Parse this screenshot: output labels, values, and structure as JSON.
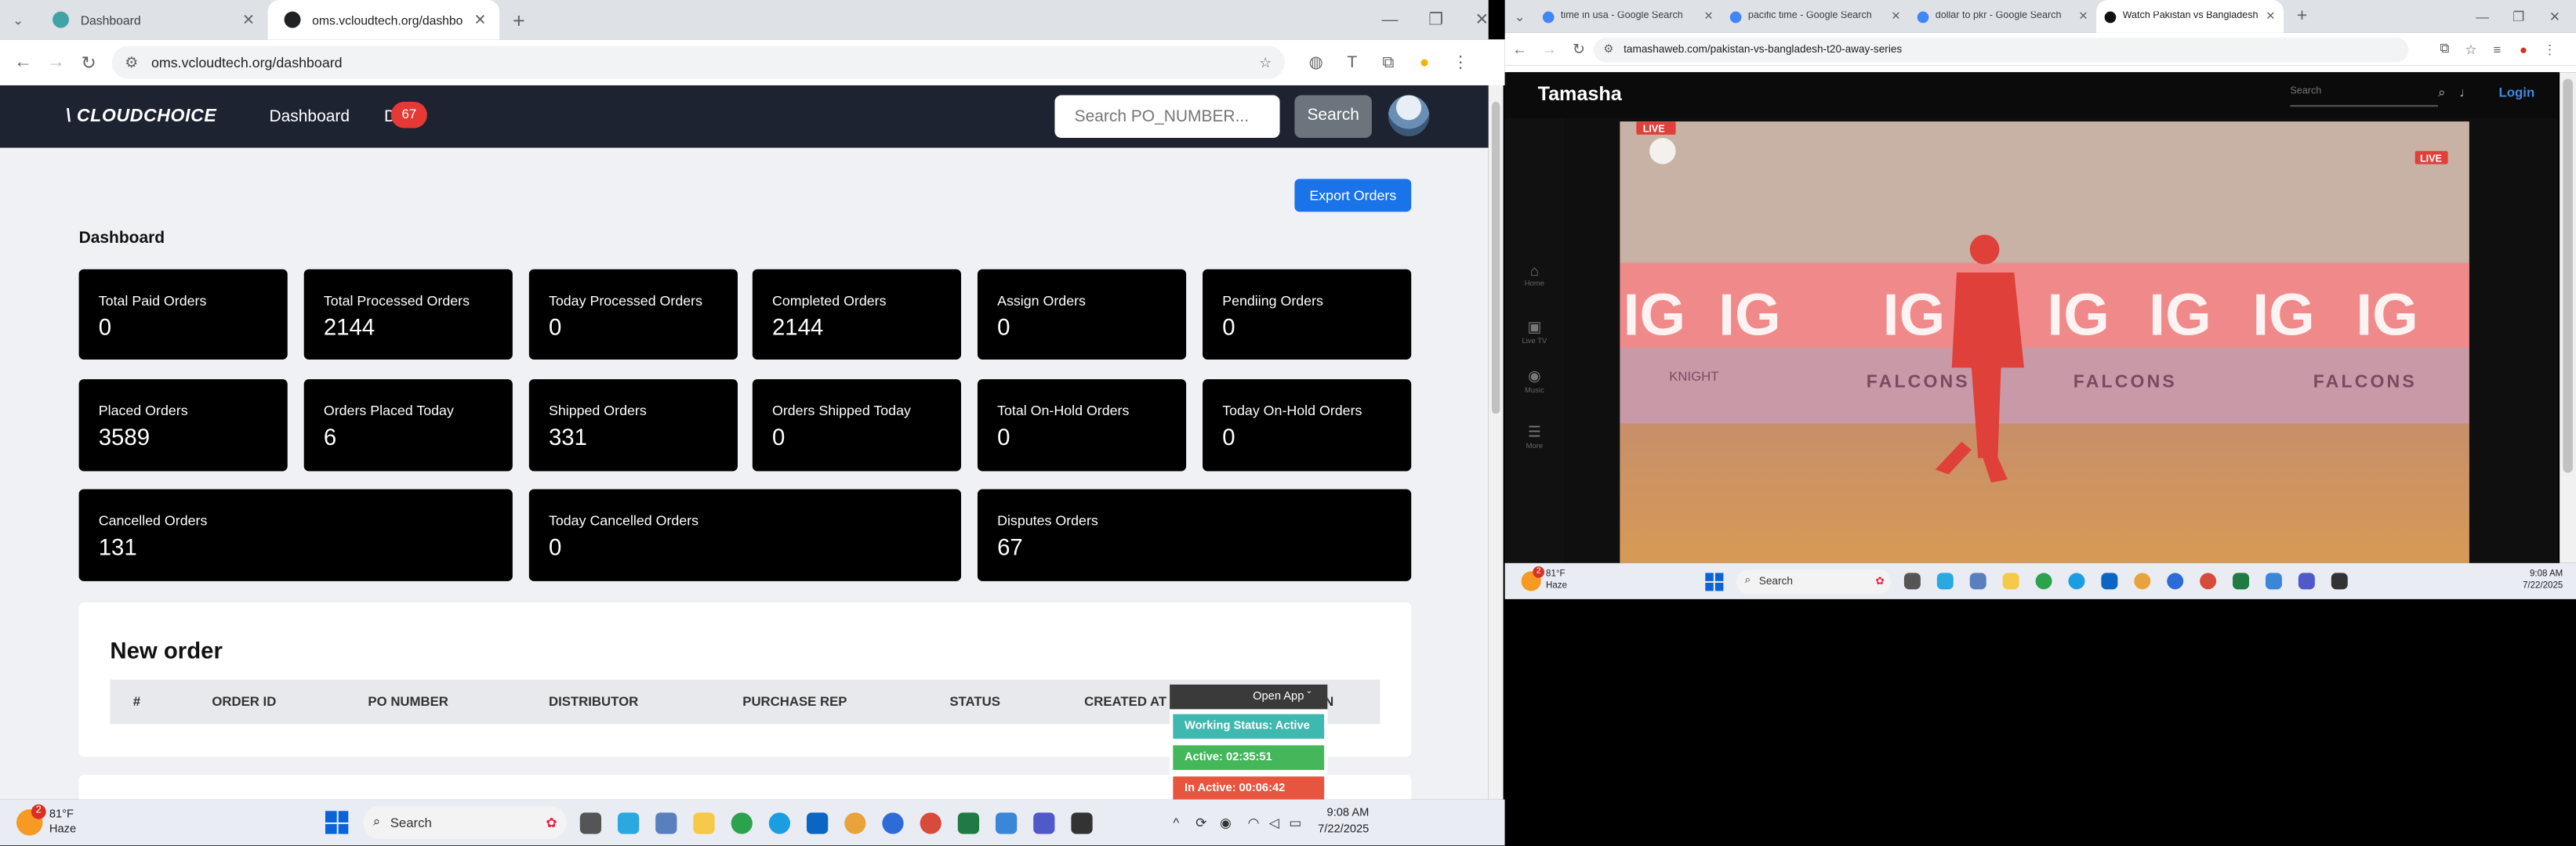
{
  "left_browser": {
    "tabs": [
      {
        "title": "Dashboard",
        "active": false
      },
      {
        "title": "oms.vcloudtech.org/dashboard",
        "active": true
      }
    ],
    "url": "oms.vcloudtech.org/dashboard"
  },
  "app": {
    "logo": "\\ CLOUDCHOICE",
    "nav": [
      {
        "label": "Dashboard"
      },
      {
        "label": "Dispu"
      }
    ],
    "dispute_badge": "67",
    "search_placeholder": "Search PO_NUMBER...",
    "search_button": "Search",
    "export_button": "Export Orders",
    "page_title": "Dashboard",
    "cards": [
      {
        "label": "Total Paid Orders",
        "value": "0"
      },
      {
        "label": "Total Processed Orders",
        "value": "2144"
      },
      {
        "label": "Today Processed Orders",
        "value": "0"
      },
      {
        "label": "Completed Orders",
        "value": "2144"
      },
      {
        "label": "Assign Orders",
        "value": "0"
      },
      {
        "label": "Pendiing Orders",
        "value": "0"
      },
      {
        "label": "Placed Orders",
        "value": "3589"
      },
      {
        "label": "Orders Placed Today",
        "value": "6"
      },
      {
        "label": "Shipped Orders",
        "value": "331"
      },
      {
        "label": "Orders Shipped Today",
        "value": "0"
      },
      {
        "label": "Total On-Hold Orders",
        "value": "0"
      },
      {
        "label": "Today On-Hold Orders",
        "value": "0"
      },
      {
        "label": "Cancelled Orders",
        "value": "131"
      },
      {
        "label": "Today Cancelled Orders",
        "value": "0"
      },
      {
        "label": "Disputes Orders",
        "value": "67"
      }
    ],
    "new_order": {
      "title": "New order",
      "columns": [
        "#",
        "ORDER ID",
        "PO NUMBER",
        "DISTRIBUTOR",
        "PURCHASE REP",
        "STATUS",
        "CREATED AT",
        "N"
      ]
    }
  },
  "tracker_popup": {
    "open_app": "Open App",
    "working_status": "Working Status: Active",
    "active": "Active: 02:35:51",
    "inactive": "In Active: 00:06:42",
    "colors": {
      "working": "#3fb8af",
      "active": "#43b75a",
      "inactive": "#e8553f"
    }
  },
  "taskbar_left": {
    "weather_temp": "81°F",
    "weather_desc": "Haze",
    "weather_alert": "2",
    "search": "Search",
    "time": "9:08 AM",
    "date": "7/22/2025"
  },
  "right_browser": {
    "tabs": [
      {
        "title": "time in usa - Google Search"
      },
      {
        "title": "pacific time - Google Search"
      },
      {
        "title": "dollar to pkr - Google Search"
      },
      {
        "title": "Watch Pakistan vs Bangladesh"
      }
    ],
    "url": "tamashaweb.com/pakistan-vs-bangladesh-t20-away-series",
    "site": {
      "logo": "Tamasha",
      "search_placeholder": "Search",
      "login": "Login",
      "side": [
        "Home",
        "Live TV",
        "Music",
        "More"
      ],
      "video": {
        "live_tags": [
          "LIVE",
          "LIVE"
        ],
        "boards": [
          "IG",
          "IG",
          "IG",
          "IG",
          "IG",
          "IG",
          "IG"
        ],
        "falcons": [
          "FALCONS",
          "FALCONS",
          "FALCONS"
        ],
        "knight": "KNIGHT"
      }
    }
  },
  "taskbar_right": {
    "weather_temp": "81°F",
    "weather_desc": "Haze",
    "weather_alert": "2",
    "search": "Search",
    "time": "9:08 AM",
    "date": "7/22/2025"
  }
}
